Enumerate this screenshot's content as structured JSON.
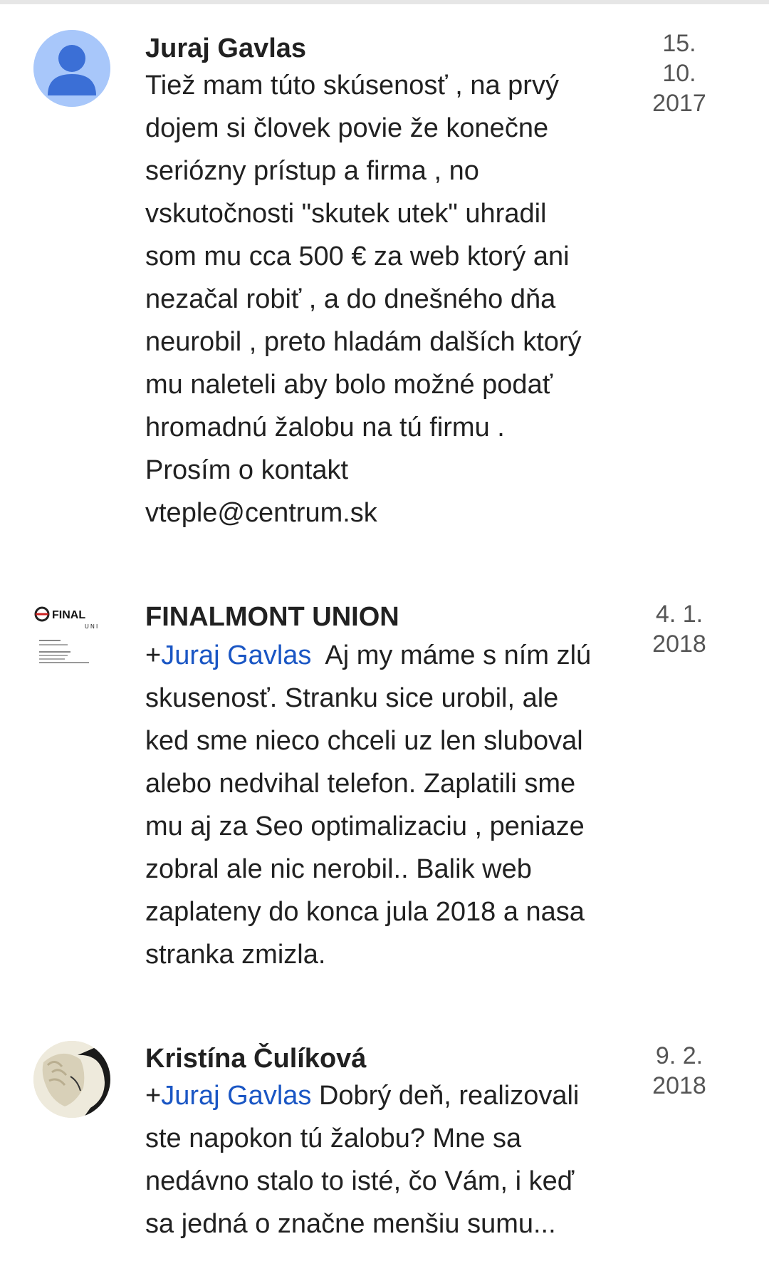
{
  "comments": [
    {
      "author": "Juraj Gavlas",
      "date_lines": [
        "15.",
        "10.",
        "2017"
      ],
      "avatar": "default-user-icon",
      "lines": [
        "Tiež mam túto skúsenosť , na prvý",
        "dojem si človek povie že konečne",
        "seriózny prístup a firma , no",
        "vskutočnosti \"skutek utek\" uhradil",
        "som mu cca 500 € za web ktorý ani",
        "nezačal robiť , a do dnešného dňa",
        "neurobil , preto hladám dalších ktorý",
        "mu naleteli aby bolo možné podať",
        "hromadnú žalobu na tú firmu .",
        "Prosím o kontakt",
        "vteple@centrum.sk"
      ]
    },
    {
      "author": "FINALMONT UNION",
      "date_lines": [
        "4. 1.",
        "2018"
      ],
      "avatar": "finalmont-logo",
      "logo_text": "FINAL",
      "logo_sub": "U N I",
      "mention_prefix": "+",
      "mention": "Juraj Gavlas",
      "first_line_rest": "  Aj my máme s ním zlú",
      "lines": [
        "skusenosť. Stranku sice urobil, ale",
        "ked sme nieco chceli uz len sluboval",
        "alebo nedvihal telefon. Zaplatili sme",
        "mu aj za Seo optimalizaciu , peniaze",
        "zobral ale nic nerobil.. Balik web",
        "zaplateny do konca jula 2018 a nasa",
        "stranka zmizla."
      ]
    },
    {
      "author": "Kristína Čulíková",
      "date_lines": [
        "9. 2.",
        "2018"
      ],
      "avatar": "profile-photo",
      "mention_prefix": "+",
      "mention": "Juraj Gavlas",
      "first_line_rest": " Dobrý deň, realizovali",
      "lines": [
        "ste napokon tú žalobu? Mne sa",
        "nedávno stalo to isté, čo Vám, i keď",
        "sa jedná o značne menšiu sumu..."
      ]
    }
  ],
  "colors": {
    "mention": "#1a56c4",
    "text": "#212121",
    "date": "#555555",
    "default_avatar_bg": "#a8c7fa",
    "default_avatar_fg": "#3b6fd6"
  }
}
